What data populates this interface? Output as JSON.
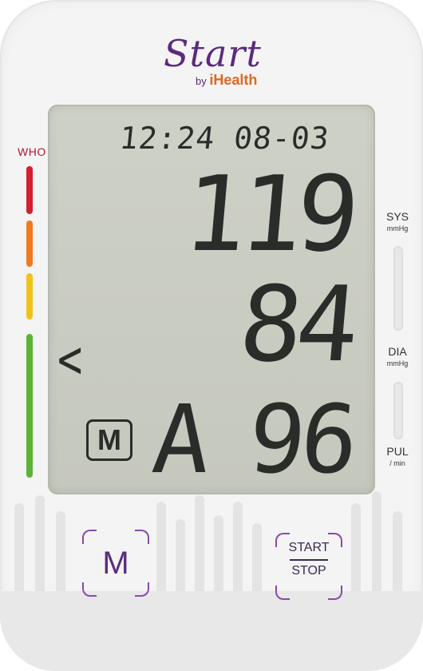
{
  "brand": {
    "logo": "Start",
    "by": "by",
    "company": "iHealth"
  },
  "who": {
    "label": "WHO"
  },
  "display": {
    "time": "12:24 08-03",
    "systolic": "119",
    "diastolic": "84",
    "average_indicator": "A",
    "pulse": "96",
    "memory_badge": "M",
    "arrow": "<"
  },
  "labels": {
    "sys": {
      "title": "SYS",
      "unit": "mmHg"
    },
    "dia": {
      "title": "DIA",
      "unit": "mmHg"
    },
    "pul": {
      "title": "PUL",
      "unit": "/ min"
    }
  },
  "buttons": {
    "memory": {
      "label": "M"
    },
    "start_stop": {
      "top": "START",
      "bottom": "STOP"
    }
  },
  "colors": {
    "brand_purple": "#5b2a7e",
    "brand_orange": "#e2661e",
    "who_red": "#d61f2c",
    "who_orange": "#f07a1e",
    "who_yellow": "#f2c21a",
    "who_green": "#5bb535",
    "lcd_background": "#ccd0c5"
  },
  "icons": {
    "mem_button": "memory-icon",
    "arrow": "chevron-left-icon"
  }
}
